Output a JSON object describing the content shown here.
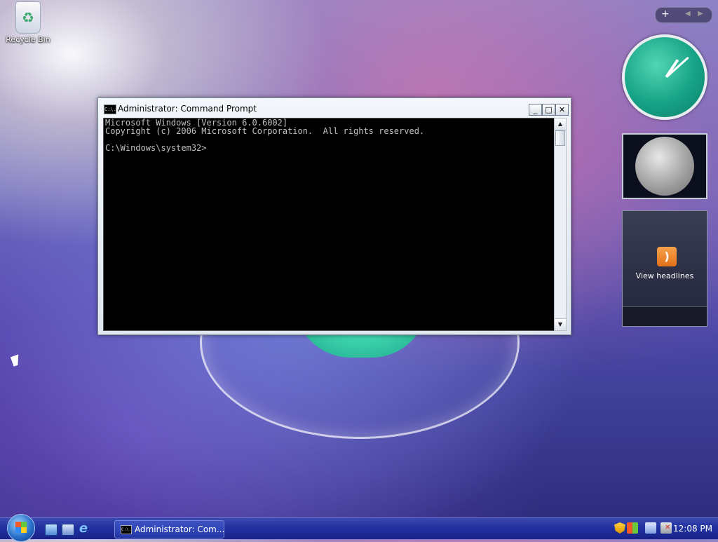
{
  "desktop": {
    "icons": [
      {
        "label": "Recycle Bin",
        "icon": "recycle-bin-icon"
      }
    ]
  },
  "window": {
    "title": "Administrator: Command Prompt",
    "icon": "console-icon",
    "icon_text": "C:\\.",
    "controls": {
      "minimize": "_",
      "maximize": "□",
      "close": "✕"
    },
    "console_text": "Microsoft Windows [Version 6.0.6002]\nCopyright (c) 2006 Microsoft Corporation.  All rights reserved.\n\nC:\\Windows\\system32>"
  },
  "sidebar": {
    "toolbar": {
      "add": "+",
      "prev": "◀",
      "next": "▶"
    },
    "clock": {
      "hour": 1,
      "minute": 8
    },
    "feed": {
      "label": "View headlines",
      "icon": "rss-icon"
    }
  },
  "taskbar": {
    "start_icon": "windows-logo-icon",
    "quick_launch": [
      "show-desktop-icon",
      "switch-windows-icon",
      "internet-explorer-icon"
    ],
    "ie_glyph": "e",
    "task_label": "Administrator: Com...",
    "tray": {
      "icons": [
        "security-shield-icon",
        "windows-flag-icon",
        "network-icon",
        "volume-muted-icon"
      ],
      "time": "12:08 PM"
    }
  },
  "colors": {
    "taskbar": "#2032a0",
    "clock_face": "#16a286",
    "console_bg": "#000000",
    "console_text": "#c0c0c0"
  }
}
